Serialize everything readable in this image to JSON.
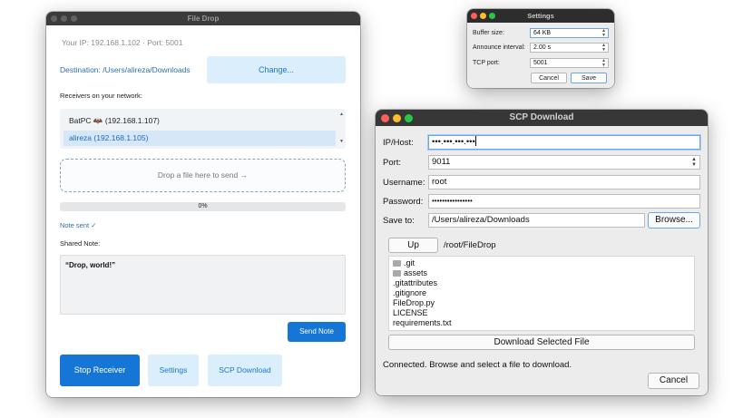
{
  "file_drop": {
    "title": "File Drop",
    "ip_port": "Your IP: 192.168.1.102 · Port: 5001",
    "destination": "Destination: /Users/alireza/Downloads",
    "change_label": "Change...",
    "receivers_label": "Receivers on your network:",
    "receivers": [
      {
        "label": "BatPC 🦇 (192.168.1.107)"
      },
      {
        "label": "alireza (192.168.1.105)"
      }
    ],
    "drop_zone": "Drop a file here to send →",
    "progress": {
      "label": "0%",
      "value": 0
    },
    "note_status": "Note sent ✓",
    "shared_note_label": "Shared Note:",
    "note_text": "“Drop, world!”",
    "send_note_label": "Send Note",
    "stop_receiver_label": "Stop Receiver",
    "settings_label": "Settings",
    "scp_download_label": "SCP Download"
  },
  "settings": {
    "title": "Settings",
    "buffer_label": "Buffer size:",
    "buffer_value": "64 KB",
    "announce_label": "Announce interval:",
    "announce_value": "2.00 s",
    "port_label": "TCP port:",
    "port_value": "5001",
    "cancel_label": "Cancel",
    "save_label": "Save"
  },
  "scp": {
    "title": "SCP Download",
    "host_label": "IP/Host:",
    "host_value": "•••.•••.•••.•••",
    "port_label": "Port:",
    "port_value": "9011",
    "username_label": "Username:",
    "username_value": "root",
    "password_label": "Password:",
    "password_value": "••••••••••••••••",
    "save_to_label": "Save to:",
    "save_to_value": "/Users/alireza/Downloads",
    "browse_label": "Browse...",
    "up_label": "Up",
    "current_path": "/root/FileDrop",
    "files": [
      {
        "name": ".git",
        "icon": "folder-icon",
        "folder": true
      },
      {
        "name": "assets",
        "icon": "folder-icon",
        "folder": true
      },
      {
        "name": ".gitattributes",
        "folder": false
      },
      {
        "name": ".gitignore",
        "folder": false
      },
      {
        "name": "FileDrop.py",
        "folder": false
      },
      {
        "name": "LICENSE",
        "folder": false
      },
      {
        "name": "requirements.txt",
        "folder": false
      }
    ],
    "download_label": "Download Selected File",
    "status": "Connected. Browse and select a file to download.",
    "cancel_label": "Cancel"
  },
  "colors": {
    "accent": "#1576d6",
    "light_button": "#dbeefb",
    "selected_row": "#d6e7f7",
    "traffic_red": "#fe5f57",
    "traffic_yellow": "#febc2e",
    "traffic_green": "#28c840",
    "focus": "#6aa6df"
  }
}
